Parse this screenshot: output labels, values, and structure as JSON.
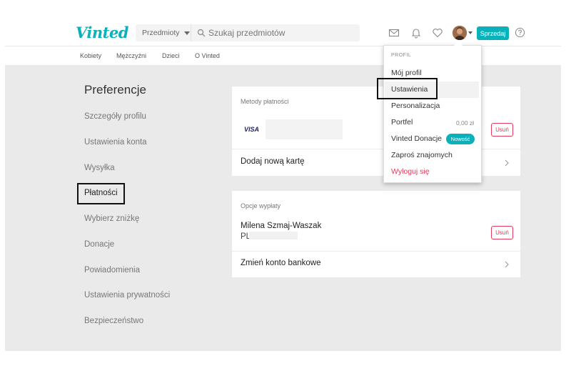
{
  "header": {
    "logo": "Vinted",
    "category_select": "Przedmioty",
    "search_placeholder": "Szukaj przedmiotów",
    "sell_label": "Sprzedaj",
    "brand_color": "#09b1ba"
  },
  "category_nav": [
    "Kobiety",
    "Mężczyźni",
    "Dzieci",
    "O Vinted"
  ],
  "sidebar": {
    "title": "Preferencje",
    "items": [
      {
        "label": "Szczegóły profilu"
      },
      {
        "label": "Ustawienia konta"
      },
      {
        "label": "Wysyłka"
      },
      {
        "label": "Płatności",
        "active": true
      },
      {
        "label": "Wybierz zniżkę"
      },
      {
        "label": "Donacje"
      },
      {
        "label": "Powiadomienia"
      },
      {
        "label": "Ustawienia prywatności"
      },
      {
        "label": "Bezpieczeństwo"
      }
    ]
  },
  "payment_methods": {
    "section_label": "Metody płatności",
    "card_brand": "VISA",
    "remove_label": "Usuń",
    "add_card_label": "Dodaj nową kartę"
  },
  "payout": {
    "section_label": "Opcje wypłaty",
    "holder_name": "Milena Szmaj-Waszak",
    "iban_prefix": "PL",
    "remove_label": "Usuń",
    "change_account_label": "Zmień konto bankowe"
  },
  "profile_menu": {
    "header": "PROFIL",
    "items": [
      {
        "label": "Mój profil"
      },
      {
        "label": "Ustawienia",
        "highlighted": true
      },
      {
        "label": "Personalizacja"
      },
      {
        "label": "Portfel",
        "amount": "0,00 zł"
      },
      {
        "label": "Vinted Donacje",
        "badge": "Nowość"
      },
      {
        "label": "Zaproś znajomych"
      },
      {
        "label": "Wyloguj się",
        "color": "#e23b5b"
      }
    ]
  }
}
